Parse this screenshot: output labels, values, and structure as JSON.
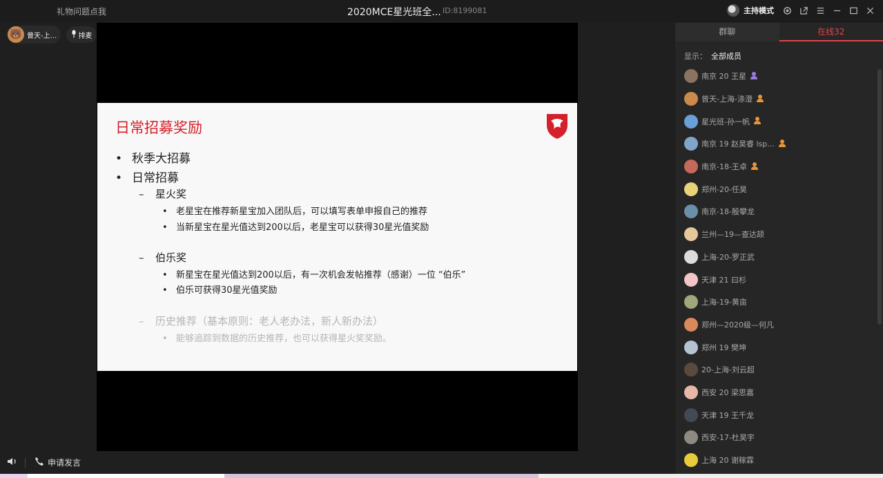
{
  "topbar": {
    "gift_link": "礼物问题点我",
    "title": "2020MCE星光班全...",
    "room_id": "ID:8199081",
    "host_mode": "主持模式"
  },
  "speaker": {
    "name": "曾天-上..."
  },
  "queue_label": "排麦",
  "slide": {
    "title": "日常招募奖励",
    "items": [
      {
        "level": 1,
        "text": "秋季大招募"
      },
      {
        "level": 1,
        "text": "日常招募"
      },
      {
        "level": 2,
        "text": "星火奖"
      },
      {
        "level": 3,
        "text": "老星宝在推荐新星宝加入团队后，可以填写表单申报自己的推荐"
      },
      {
        "level": 3,
        "text": "当新星宝在星光值达到200以后，老星宝可以获得30星光值奖励"
      },
      {
        "level": 2,
        "text": "伯乐奖"
      },
      {
        "level": 3,
        "text": "新星宝在星光值达到200以后，有一次机会发帖推荐（感谢）一位 “伯乐”"
      },
      {
        "level": 3,
        "text": "伯乐可获得30星光值奖励"
      },
      {
        "level": 2,
        "text": "历史推荐（基本原则：老人老办法，新人新办法）"
      },
      {
        "level": 3,
        "text": "能够追踪到数据的历史推荐，也可以获得星火奖奖励。"
      }
    ]
  },
  "bottom": {
    "apply_label": "申请发言"
  },
  "panel": {
    "tabs": [
      "群聊",
      "在线32"
    ],
    "filter_label": "显示：",
    "filter_value": "全部成员",
    "members": [
      {
        "name": "南京 20  王星",
        "badge": "purple"
      },
      {
        "name": "曾天-上海-涤澄",
        "badge": "orange"
      },
      {
        "name": "星光班-孙一帆",
        "badge": "orange"
      },
      {
        "name": "南京 19 赵昊睿 lsp...",
        "badge": "orange"
      },
      {
        "name": "南京-18-王卓",
        "badge": "orange"
      },
      {
        "name": "郑州-20-任昊",
        "badge": ""
      },
      {
        "name": "南京-18-殷攀龙",
        "badge": ""
      },
      {
        "name": "兰州—19—查达颉",
        "badge": ""
      },
      {
        "name": "上海-20-罗正武",
        "badge": ""
      },
      {
        "name": "天津 21 曰杉",
        "badge": ""
      },
      {
        "name": "上海-19-黄亩",
        "badge": ""
      },
      {
        "name": "郑州—2020级—何凡",
        "badge": ""
      },
      {
        "name": "郑州 19 樊坤",
        "badge": ""
      },
      {
        "name": "20-上海-刘云超",
        "badge": ""
      },
      {
        "name": "西安 20 梁思嘉",
        "badge": ""
      },
      {
        "name": "天津  19 王千龙",
        "badge": ""
      },
      {
        "name": "西安-17-杜昊宇",
        "badge": ""
      },
      {
        "name": "上海  20  谢稼霖",
        "badge": ""
      }
    ]
  },
  "colors": {
    "accent": "#e0464b",
    "slide_title": "#d4202a"
  }
}
